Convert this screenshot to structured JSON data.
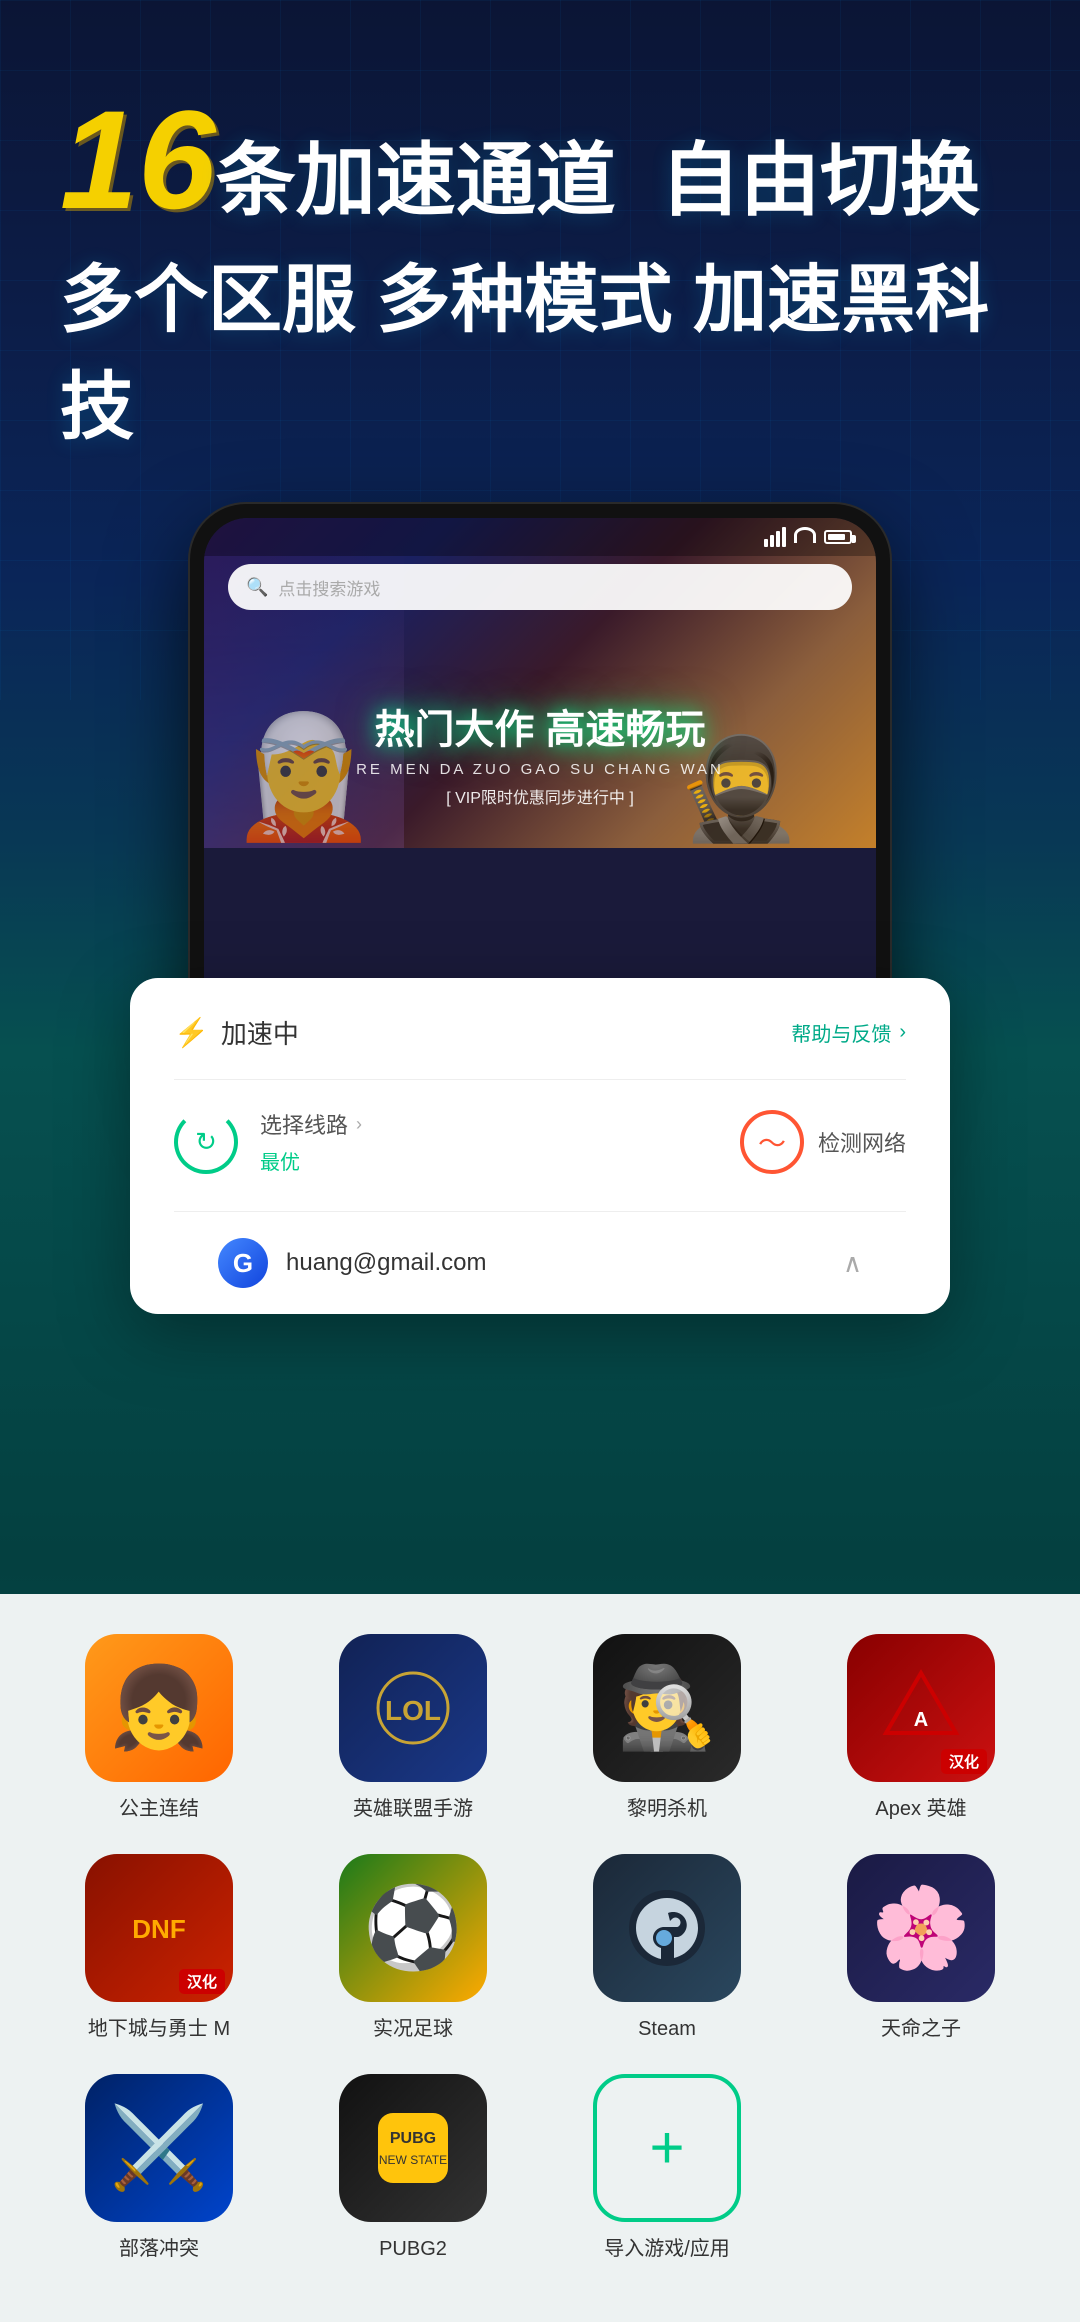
{
  "hero": {
    "number": "16",
    "title1_part1": "条加速通道",
    "title1_part2": "自由切换",
    "title2": "多个区服  多种模式  加速黑科技"
  },
  "phone": {
    "search_placeholder": "点击搜索游戏",
    "banner": {
      "main_text": "热门大作  高速畅玩",
      "sub_text": "RE MEN DA ZUO GAO SU CHANG WAN",
      "vip_text": "[ VIP限时优惠同步进行中 ]"
    }
  },
  "accel_card": {
    "status": "加速中",
    "help_label": "帮助与反馈",
    "route_label": "选择线路",
    "route_value": "最优",
    "network_label": "检测网络",
    "account_email": "huang@gmail.com",
    "account_initial": "G"
  },
  "games": [
    {
      "id": "princess",
      "name": "公主连结",
      "icon_type": "princess",
      "badge": false
    },
    {
      "id": "lol",
      "name": "英雄联盟手游",
      "icon_type": "lol",
      "badge": false
    },
    {
      "id": "dawn",
      "name": "黎明杀机",
      "icon_type": "dawn",
      "badge": false
    },
    {
      "id": "apex",
      "name": "Apex 英雄",
      "icon_type": "apex",
      "badge": true
    },
    {
      "id": "dnf",
      "name": "地下城与勇士 M",
      "icon_type": "dnf",
      "badge": true
    },
    {
      "id": "soccer",
      "name": "实况足球",
      "icon_type": "soccer",
      "badge": false
    },
    {
      "id": "steam",
      "name": "Steam",
      "icon_type": "steam",
      "badge": false
    },
    {
      "id": "tianming",
      "name": "天命之子",
      "icon_type": "tianming",
      "badge": false
    },
    {
      "id": "clash",
      "name": "部落冲突",
      "icon_type": "clash",
      "badge": false
    },
    {
      "id": "pubg",
      "name": "PUBG2",
      "icon_type": "pubg",
      "badge": false
    },
    {
      "id": "add",
      "name": "导入游戏/应用",
      "icon_type": "add",
      "badge": false
    }
  ]
}
